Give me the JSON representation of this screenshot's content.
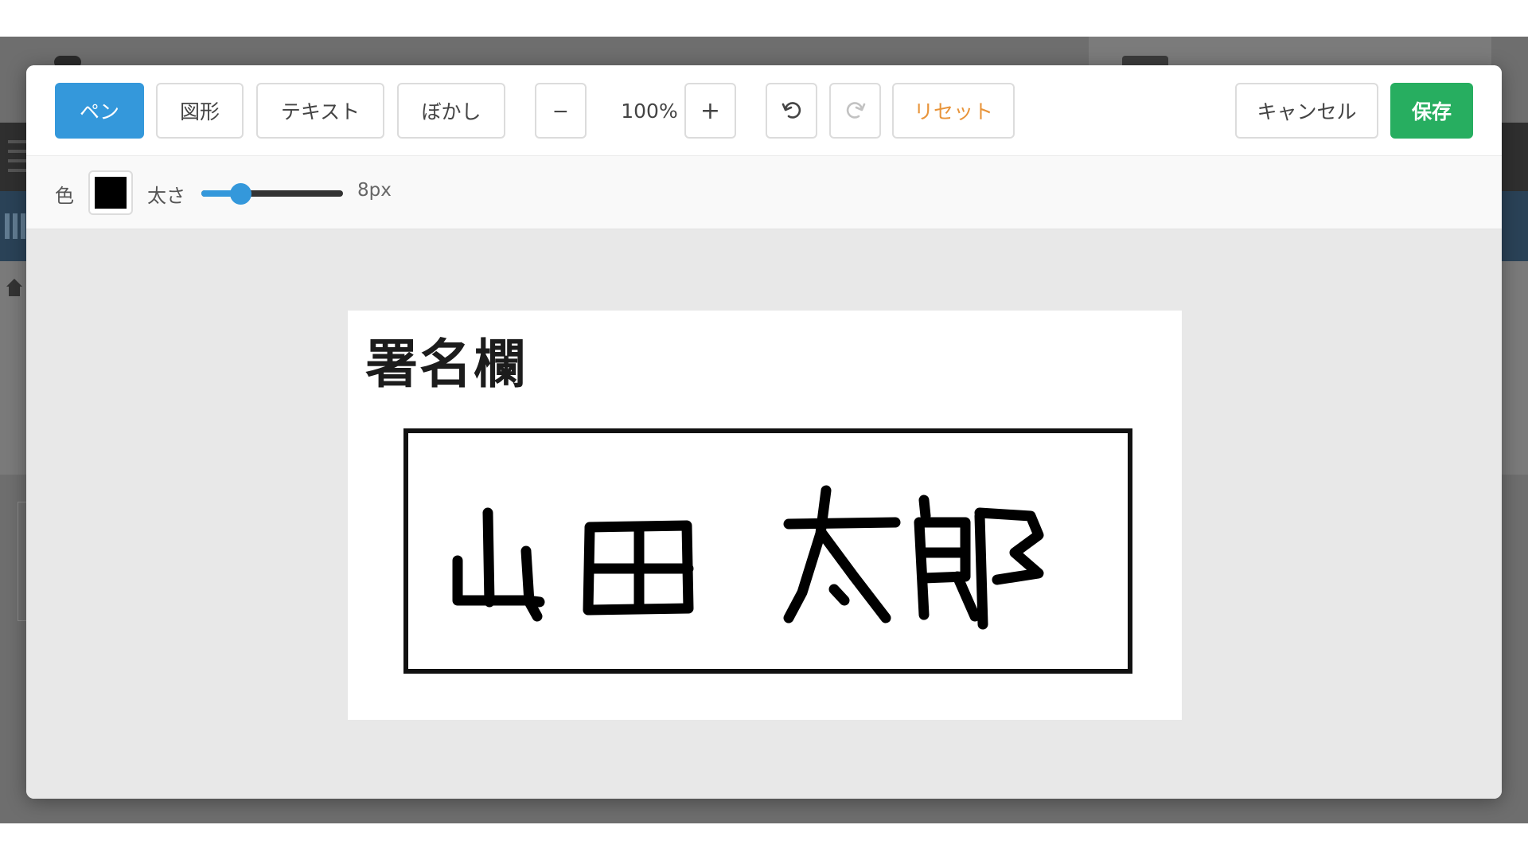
{
  "toolbar": {
    "tools": {
      "pen": "ペン",
      "shape": "図形",
      "text": "テキスト",
      "blur": "ぼかし"
    },
    "zoom": {
      "decrease": "−",
      "level": "100%",
      "increase": "+"
    },
    "reset_label": "リセット",
    "cancel_label": "キャンセル",
    "save_label": "保存"
  },
  "options": {
    "color_label": "色",
    "color_value": "#000000",
    "width_label": "太さ",
    "width_value_text": "8px"
  },
  "document": {
    "title": "署名欄"
  },
  "colors": {
    "accent": "#3498db",
    "save": "#27ae60",
    "reset": "#e8943a"
  },
  "icons": {
    "undo": "undo-icon",
    "redo": "redo-icon"
  }
}
